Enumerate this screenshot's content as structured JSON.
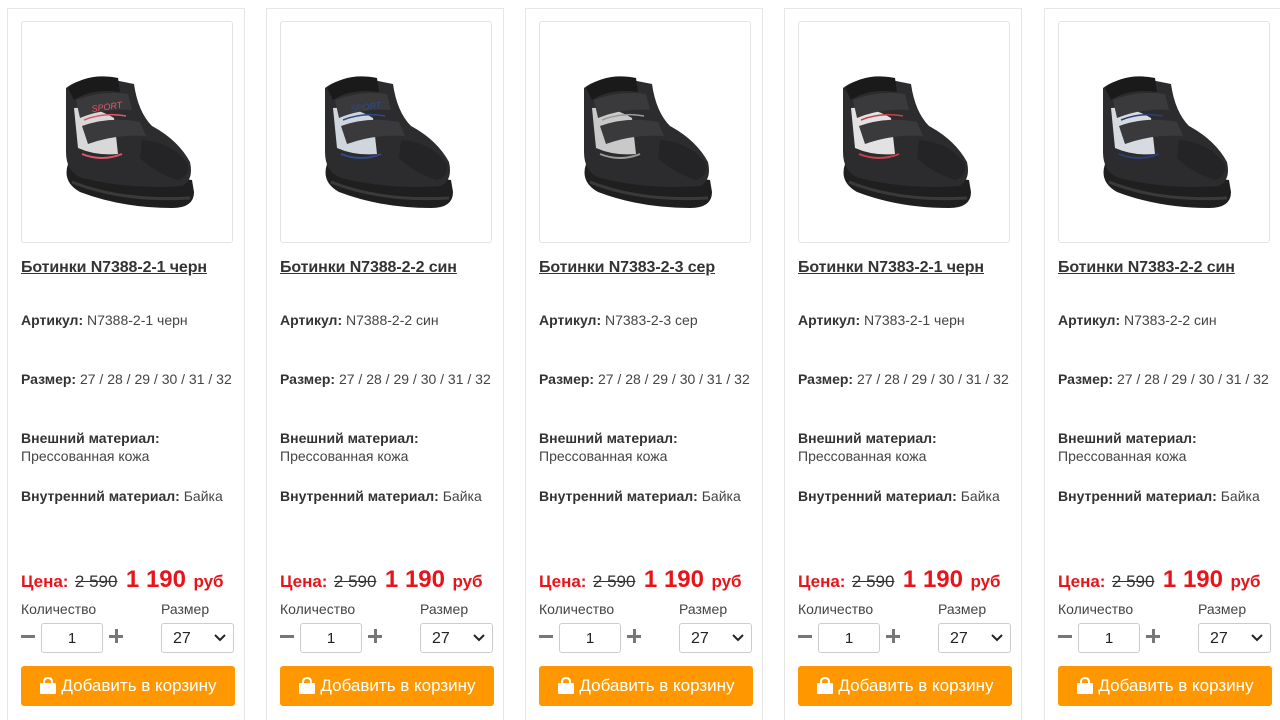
{
  "labels": {
    "article": "Артикул:",
    "size": "Размер:",
    "outer": "Внешний материал:",
    "inner": "Внутренний материал:",
    "price": "Цена:",
    "currency": "руб",
    "quantity": "Количество",
    "size_select": "Размер",
    "add_to_cart": "Добавить в корзину"
  },
  "colors": {
    "accent": "#ff9800",
    "price_red": "#e8141b"
  },
  "icons": {
    "cart": "shopping-bag-icon",
    "minus": "minus-icon",
    "plus": "plus-icon",
    "select": "chevron-down-icon"
  },
  "products": [
    {
      "title": "Ботинки N7388-2-1 черн",
      "article": "N7388-2-1 черн",
      "sizes": "27 / 28 / 29 / 30 / 31 / 32",
      "outer": "Прессованная кожа",
      "inner": "Байка",
      "old_price": "2 590",
      "new_price": "1 190",
      "quantity": "1",
      "size_selected": "27",
      "shoe_accent": "#e0576a",
      "shoe_panel": "#d8d8d8",
      "shoe_text": "SPORT"
    },
    {
      "title": "Ботинки N7388-2-2 син",
      "article": "N7388-2-2 син",
      "sizes": "27 / 28 / 29 / 30 / 31 / 32",
      "outer": "Прессованная кожа",
      "inner": "Байка",
      "old_price": "2 590",
      "new_price": "1 190",
      "quantity": "1",
      "size_selected": "27",
      "shoe_accent": "#2f4a8a",
      "shoe_panel": "#cfd6de",
      "shoe_text": "SPORT"
    },
    {
      "title": "Ботинки N7383-2-3 сер",
      "article": "N7383-2-3 сер",
      "sizes": "27 / 28 / 29 / 30 / 31 / 32",
      "outer": "Прессованная кожа",
      "inner": "Байка",
      "old_price": "2 590",
      "new_price": "1 190",
      "quantity": "1",
      "size_selected": "27",
      "shoe_accent": "#9a9a9a",
      "shoe_panel": "#c9c9c9",
      "shoe_text": ""
    },
    {
      "title": "Ботинки N7383-2-1 черн",
      "article": "N7383-2-1 черн",
      "sizes": "27 / 28 / 29 / 30 / 31 / 32",
      "outer": "Прессованная кожа",
      "inner": "Байка",
      "old_price": "2 590",
      "new_price": "1 190",
      "quantity": "1",
      "size_selected": "27",
      "shoe_accent": "#c8404a",
      "shoe_panel": "#e2e2e2",
      "shoe_text": ""
    },
    {
      "title": "Ботинки N7383-2-2 син",
      "article": "N7383-2-2 син",
      "sizes": "27 / 28 / 29 / 30 / 31 / 32",
      "outer": "Прессованная кожа",
      "inner": "Байка",
      "old_price": "2 590",
      "new_price": "1 190",
      "quantity": "1",
      "size_selected": "27",
      "shoe_accent": "#2a3f78",
      "shoe_panel": "#d6dbe2",
      "shoe_text": ""
    }
  ]
}
